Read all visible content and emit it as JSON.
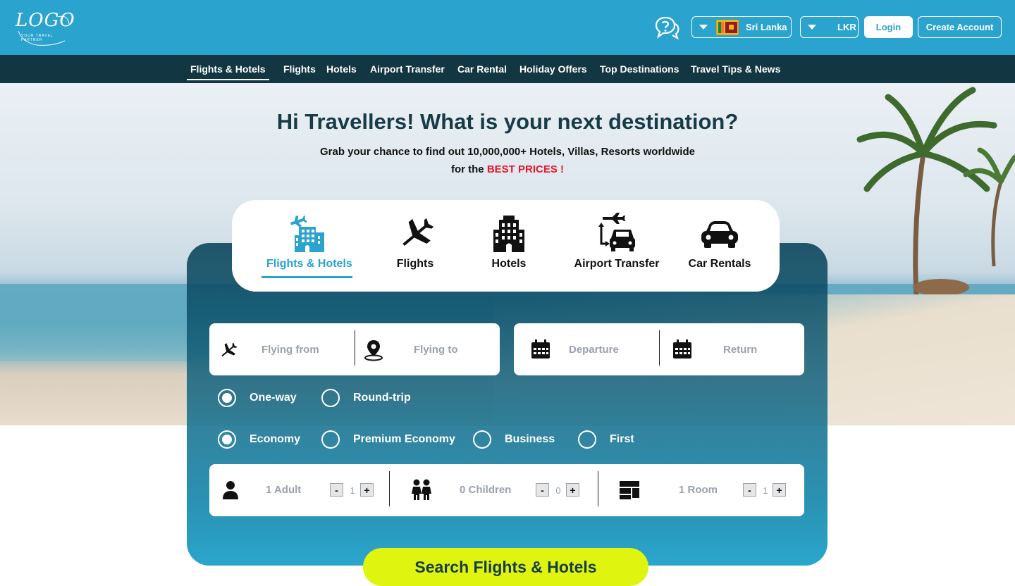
{
  "header": {
    "logo_text": "LOGO",
    "logo_tagline": "YOUR TRAVEL PARTNER",
    "country_label": "Sri Lanka",
    "currency_label": "LKR",
    "login_label": "Login",
    "create_account_label": "Create Account",
    "icons": [
      "help-chat-icon",
      "chevron-down-icon",
      "sri-lanka-flag-icon"
    ]
  },
  "nav": {
    "items": [
      {
        "label": "Flights & Hotels",
        "active": true
      },
      {
        "label": "Flights"
      },
      {
        "label": "Hotels"
      },
      {
        "label": "Airport Transfer"
      },
      {
        "label": "Car Rental"
      },
      {
        "label": "Holiday Offers"
      },
      {
        "label": "Top Destinations"
      },
      {
        "label": "Travel Tips & News"
      }
    ]
  },
  "hero": {
    "headline": "Hi Travellers! What is your next destination?",
    "subline_1": "Grab your chance to find out 10,000,000+ Hotels, Villas, Resorts worldwide",
    "subline_2_prefix": "for the ",
    "subline_2_highlight": "BEST PRICES !"
  },
  "search": {
    "tabs": [
      {
        "label": "Flights & Hotels",
        "icon": "flight-hotel-icon",
        "active": true
      },
      {
        "label": "Flights",
        "icon": "airplane-icon"
      },
      {
        "label": "Hotels",
        "icon": "hotel-building-icon"
      },
      {
        "label": "Airport Transfer",
        "icon": "airport-transfer-icon"
      },
      {
        "label": "Car Rentals",
        "icon": "car-icon"
      }
    ],
    "flying_from_placeholder": "Flying from",
    "flying_to_placeholder": "Flying to",
    "departure_placeholder": "Departure",
    "return_placeholder": "Return",
    "trip_types": [
      {
        "label": "One-way",
        "checked": true
      },
      {
        "label": "Round-trip",
        "checked": false
      }
    ],
    "cabin_classes": [
      {
        "label": "Economy",
        "checked": true
      },
      {
        "label": "Premium Economy",
        "checked": false
      },
      {
        "label": "Business",
        "checked": false
      },
      {
        "label": "First",
        "checked": false
      }
    ],
    "adults": {
      "label": "1 Adult",
      "value": "1"
    },
    "children": {
      "label": "0 Children",
      "value": "0"
    },
    "rooms": {
      "label": "1 Room",
      "value": "1"
    },
    "minus": "-",
    "plus": "+",
    "submit_label": "Search Flights & Hotels"
  },
  "colors": {
    "header_bg": "#2aa3cf",
    "nav_bg": "#123742",
    "accent": "#2aa3cf",
    "highlight_red": "#e8192c",
    "search_button": "#dff40f"
  }
}
